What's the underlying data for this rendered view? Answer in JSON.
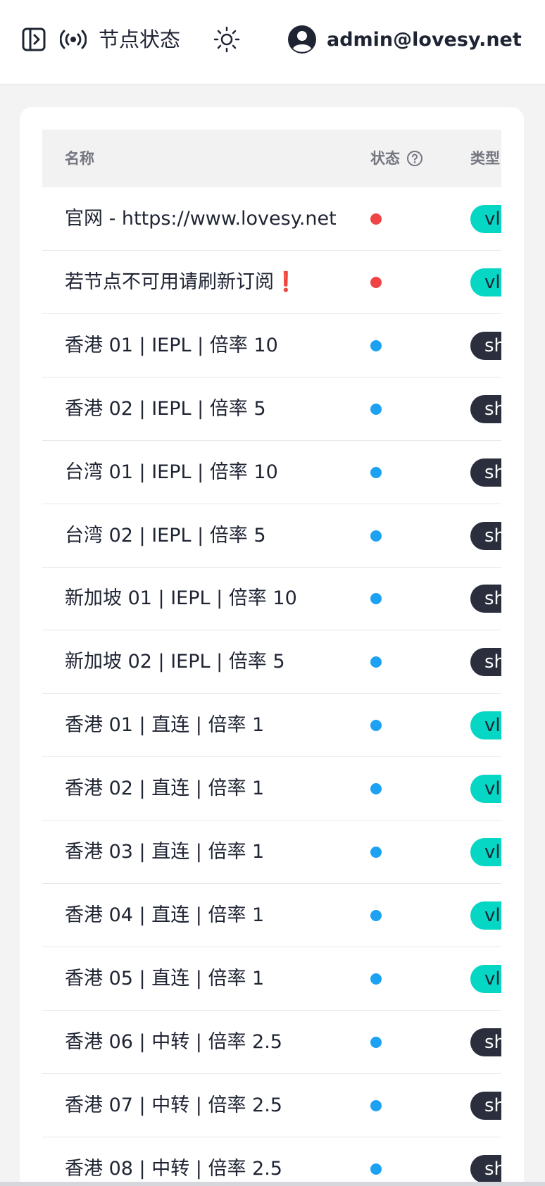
{
  "header": {
    "title": "节点状态",
    "user_email": "admin@lovesy.net",
    "icons": {
      "sidebar_toggle": "sidebar-toggle-icon",
      "signal": "broadcast-signal-icon",
      "theme": "sun-icon",
      "avatar": "user-avatar-icon"
    }
  },
  "table": {
    "columns": {
      "name": "名称",
      "status": "状态",
      "type": "类型"
    },
    "rows": [
      {
        "name": "官网 - https://www.lovesy.net",
        "status": "offline",
        "type": "vl"
      },
      {
        "name": "若节点不可用请刷新订阅",
        "suffix": "❗",
        "status": "offline",
        "type": "vl"
      },
      {
        "name": "香港 01 | IEPL | 倍率 10",
        "status": "online",
        "type": "sh"
      },
      {
        "name": "香港 02 | IEPL | 倍率 5",
        "status": "online",
        "type": "sh"
      },
      {
        "name": "台湾 01 | IEPL | 倍率 10",
        "status": "online",
        "type": "sh"
      },
      {
        "name": "台湾 02 | IEPL | 倍率 5",
        "status": "online",
        "type": "sh"
      },
      {
        "name": "新加坡 01 | IEPL | 倍率 10",
        "status": "online",
        "type": "sh"
      },
      {
        "name": "新加坡 02 | IEPL | 倍率 5",
        "status": "online",
        "type": "sh"
      },
      {
        "name": "香港 01 | 直连 | 倍率 1",
        "status": "online",
        "type": "vl"
      },
      {
        "name": "香港 02 | 直连 | 倍率 1",
        "status": "online",
        "type": "vl"
      },
      {
        "name": "香港 03 | 直连 | 倍率 1",
        "status": "online",
        "type": "vl"
      },
      {
        "name": "香港 04 | 直连 | 倍率 1",
        "status": "online",
        "type": "vl"
      },
      {
        "name": "香港 05 | 直连 | 倍率 1",
        "status": "online",
        "type": "vl"
      },
      {
        "name": "香港 06 | 中转 | 倍率 2.5",
        "status": "online",
        "type": "sh"
      },
      {
        "name": "香港 07 | 中转 | 倍率 2.5",
        "status": "online",
        "type": "sh"
      },
      {
        "name": "香港 08 | 中转 | 倍率 2.5",
        "status": "online",
        "type": "sh"
      }
    ]
  },
  "colors": {
    "status_offline": "#ef4444",
    "status_online": "#1da1f2",
    "badge_vl_bg": "#06d6c4",
    "badge_vl_text": "#1f2433",
    "badge_sh_bg": "#2b2f3d",
    "badge_sh_text": "#ffffff"
  }
}
